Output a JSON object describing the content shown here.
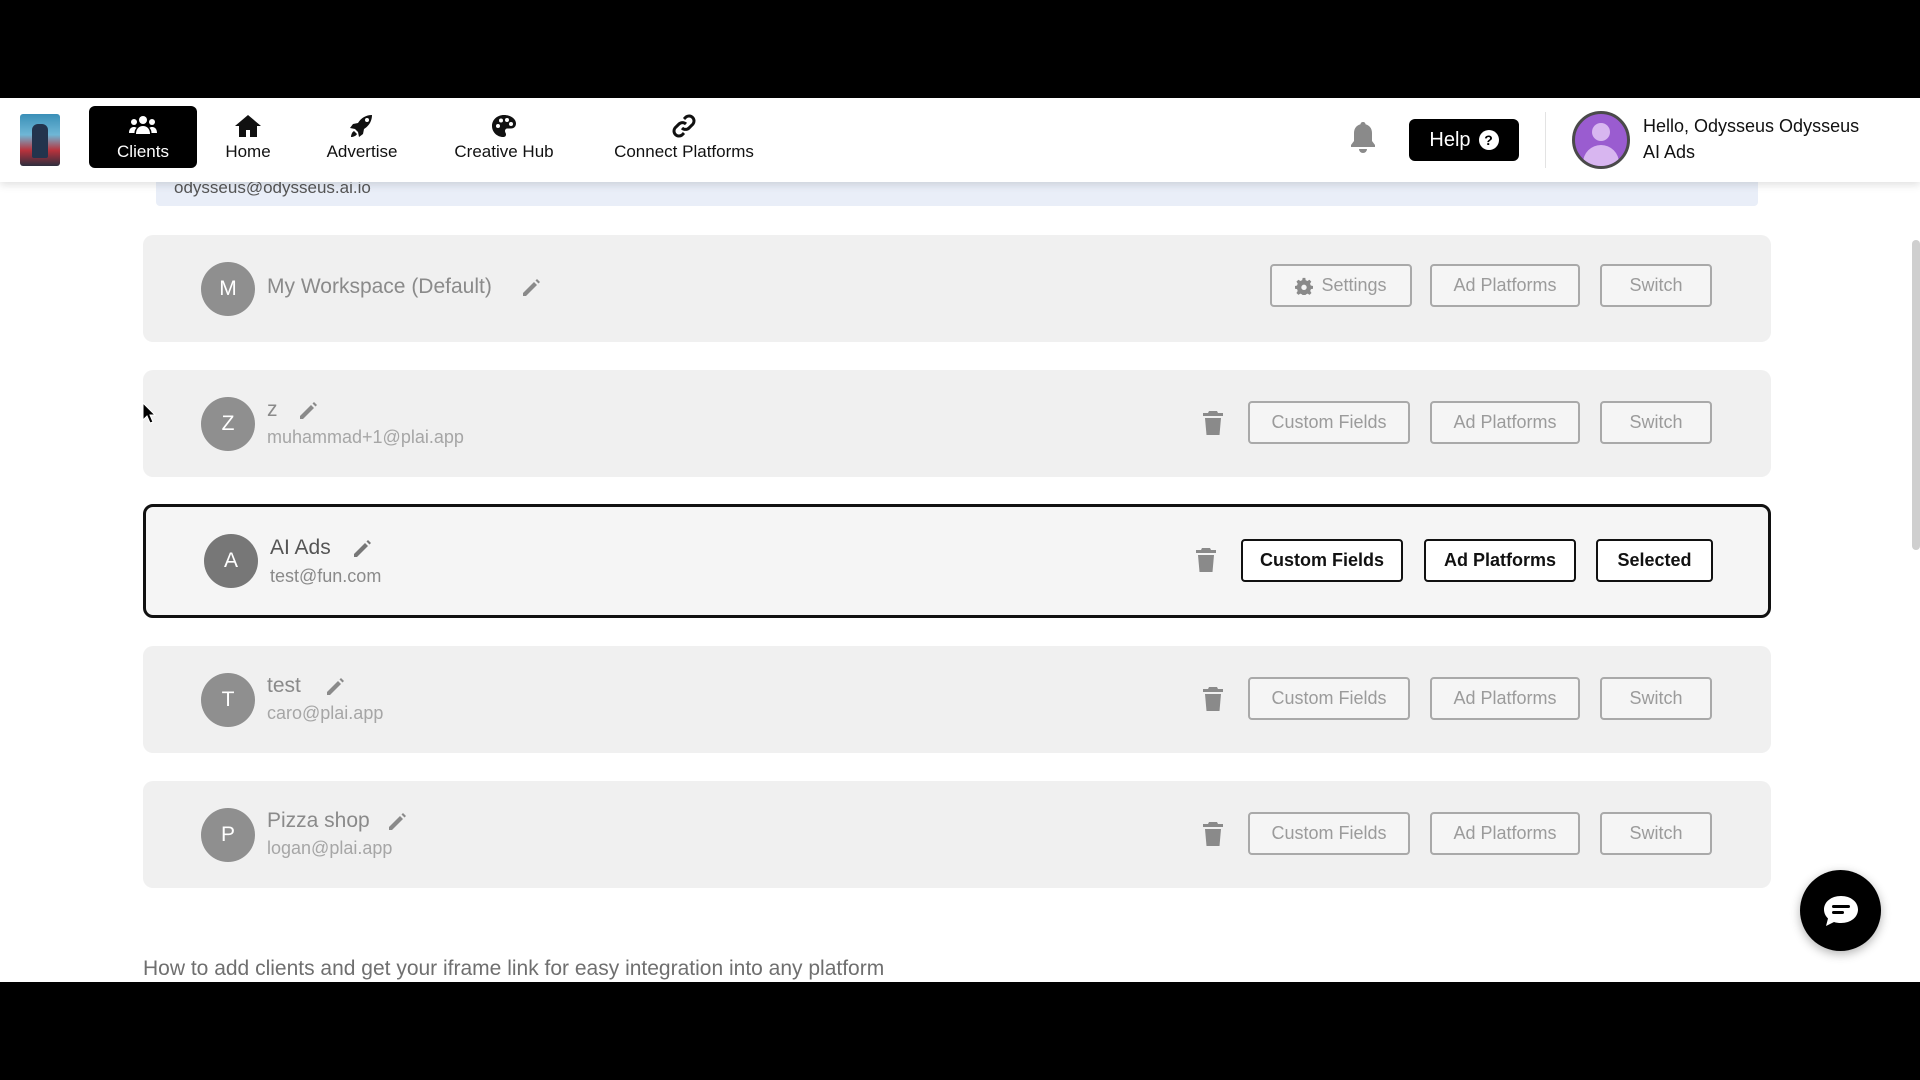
{
  "nav": {
    "items": [
      {
        "label": "Clients",
        "icon": "users-icon"
      },
      {
        "label": "Home",
        "icon": "home-icon"
      },
      {
        "label": "Advertise",
        "icon": "rocket-icon"
      },
      {
        "label": "Creative Hub",
        "icon": "palette-icon"
      },
      {
        "label": "Connect Platforms",
        "icon": "link-icon"
      }
    ],
    "active": "Clients",
    "help_label": "Help",
    "user_greeting": "Hello, Odysseus Odysseus",
    "user_org": "AI Ads"
  },
  "partial_email": "odysseus@odysseus.ai.io",
  "workspaces": [
    {
      "initial": "M",
      "name": "My Workspace (Default)",
      "email": "",
      "buttons": [
        "Settings",
        "Ad Platforms",
        "Switch"
      ],
      "deletable": false,
      "selected": false
    },
    {
      "initial": "Z",
      "name": "z",
      "email": "muhammad+1@plai.app",
      "buttons": [
        "Custom Fields",
        "Ad Platforms",
        "Switch"
      ],
      "deletable": true,
      "selected": false
    },
    {
      "initial": "A",
      "name": "AI Ads",
      "email": "test@fun.com",
      "buttons": [
        "Custom Fields",
        "Ad Platforms",
        "Selected"
      ],
      "deletable": true,
      "selected": true
    },
    {
      "initial": "T",
      "name": "test",
      "email": "caro@plai.app",
      "buttons": [
        "Custom Fields",
        "Ad Platforms",
        "Switch"
      ],
      "deletable": true,
      "selected": false
    },
    {
      "initial": "P",
      "name": "Pizza shop",
      "email": "logan@plai.app",
      "buttons": [
        "Custom Fields",
        "Ad Platforms",
        "Switch"
      ],
      "deletable": true,
      "selected": false
    }
  ],
  "footer_text": "How to add clients and get your iframe link for easy integration into any platform",
  "colors": {
    "accent": "#000000",
    "row_bg": "#f0f0f0",
    "badge": "#8f8f8f"
  }
}
